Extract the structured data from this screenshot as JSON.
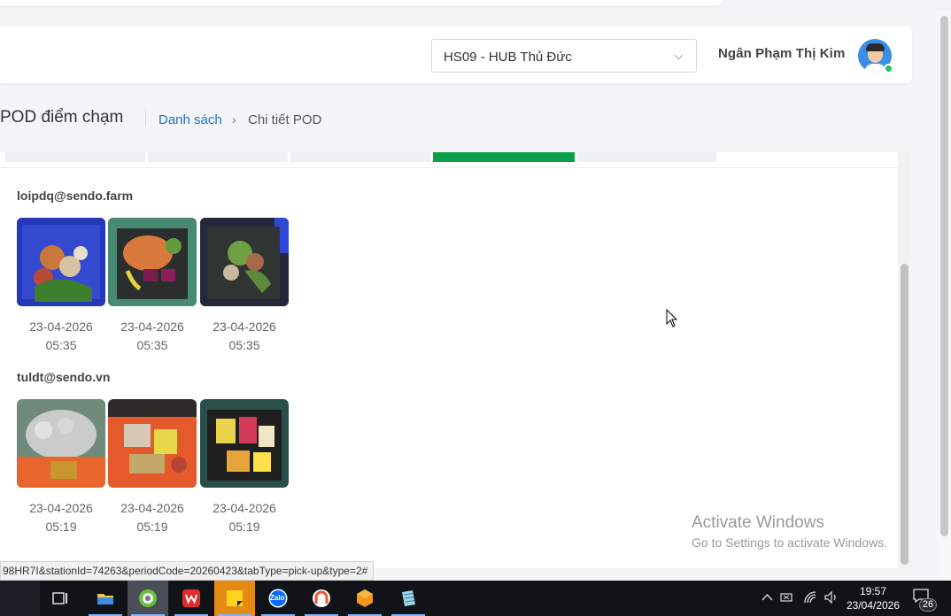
{
  "header": {
    "hub_select_value": "HS09 - HUB Thủ Đức",
    "user_name": "Ngân Phạm Thị Kim"
  },
  "breadcrumb": {
    "page_title": "POD điểm chạm",
    "link": "Danh sách",
    "separator": "›",
    "current": "Chi tiết POD"
  },
  "groups": [
    {
      "email": "loipdq@sendo.farm",
      "photos": [
        {
          "date": "23-04-2026",
          "time": "05:35"
        },
        {
          "date": "23-04-2026",
          "time": "05:35"
        },
        {
          "date": "23-04-2026",
          "time": "05:35"
        }
      ]
    },
    {
      "email": "tuldt@sendo.vn",
      "photos": [
        {
          "date": "23-04-2026",
          "time": "05:19"
        },
        {
          "date": "23-04-2026",
          "time": "05:19"
        },
        {
          "date": "23-04-2026",
          "time": "05:19"
        }
      ]
    }
  ],
  "status_url": "98HR7I&stationId=74263&periodCode=20260423&tabType=pick-up&type=2#",
  "watermark": {
    "line1": "Activate Windows",
    "line2": "Go to Settings to activate Windows."
  },
  "taskbar": {
    "apps": [
      "task-view-icon",
      "file-explorer-icon",
      "browser-icon",
      "wps-icon",
      "sticky-notes-icon",
      "zalo-icon",
      "anydesk-icon",
      "sublime-icon",
      "notepad-icon"
    ],
    "zalo_label": "Zalo",
    "clock_time": "19:57",
    "clock_date": "23/04/2026",
    "notification_count": "26"
  },
  "colors": {
    "accent_green": "#0aa04a",
    "link_blue": "#1a73c8"
  }
}
